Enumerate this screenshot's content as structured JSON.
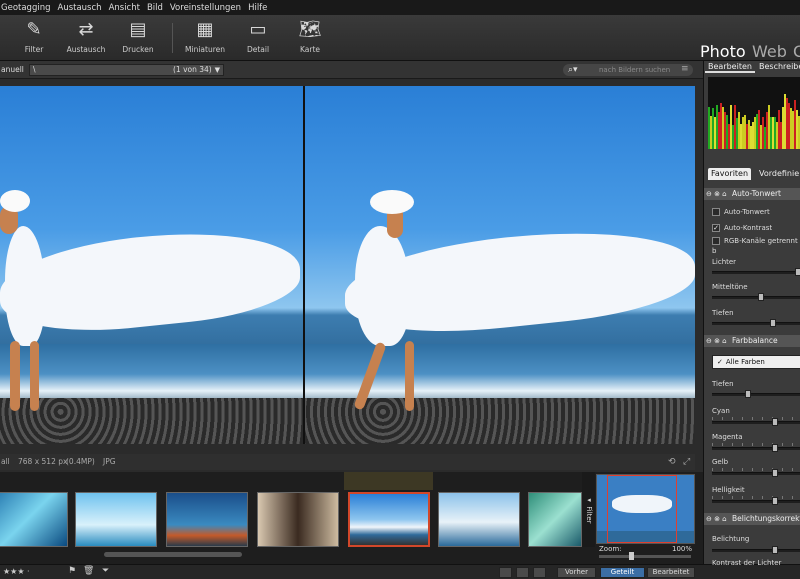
{
  "menu": [
    "Geotagging",
    "Austausch",
    "Ansicht",
    "Bild",
    "Voreinstellungen",
    "Hilfe"
  ],
  "toolbar": {
    "buttons": [
      {
        "label": "Filter",
        "icon": "eyedropper-icon"
      },
      {
        "label": "Austausch",
        "icon": "exchange-icon"
      },
      {
        "label": "Drucken",
        "icon": "printer-icon"
      },
      {
        "label": "Miniaturen",
        "icon": "grid-icon"
      },
      {
        "label": "Detail",
        "icon": "detail-icon"
      },
      {
        "label": "Karte",
        "icon": "map-icon"
      }
    ]
  },
  "modes": {
    "photo": "Photo",
    "web": "Web",
    "next": "C"
  },
  "pathbar": {
    "left_label": "anuell",
    "path": "\\",
    "counter": "(1 von 34)",
    "search_placeholder": "nach Bildern suchen"
  },
  "info": {
    "left": "all",
    "dimensions": "768 x 512 px",
    "megapixels": "(0.4MP)",
    "format": "JPG"
  },
  "filmstrip": {
    "filter_tab": "Filter",
    "zoom_label": "Zoom:",
    "zoom_value": "100%",
    "selected_index": 4
  },
  "statusbar": {
    "rating": "★★★ ·",
    "prev": "Vorher",
    "split": "Geteilt",
    "edit": "Bearbeitet"
  },
  "right_panel": {
    "top_tabs": [
      "Bearbeiten",
      "Beschreibe"
    ],
    "sub_tabs": [
      "Favoriten",
      "Vordefinie"
    ],
    "auto_tone": {
      "title": "Auto-Tonwert",
      "options": [
        {
          "label": "Auto-Tonwert",
          "checked": false
        },
        {
          "label": "Auto-Kontrast",
          "checked": true
        },
        {
          "label": "RGB-Kanäle getrennt b",
          "checked": false
        }
      ],
      "sliders": [
        {
          "label": "Lichter",
          "value": 1.0
        },
        {
          "label": "Mitteltöne",
          "value": 0.55
        },
        {
          "label": "Tiefen",
          "value": 0.7
        }
      ]
    },
    "color_balance": {
      "title": "Farbbalance",
      "select": "Alle Farben",
      "sliders": [
        {
          "label": "Tiefen",
          "value": 0.4
        },
        {
          "label": "Cyan",
          "value": 0.72
        },
        {
          "label": "Magenta",
          "value": 0.72
        },
        {
          "label": "Gelb",
          "value": 0.72
        },
        {
          "label": "Helligkeit",
          "value": 0.72
        }
      ]
    },
    "exposure": {
      "title": "Belichtungskorrektu",
      "sliders": [
        {
          "label": "Belichtung",
          "value": 0.72
        },
        {
          "label": "Kontrast der Lichter",
          "value": 0.72
        }
      ]
    }
  }
}
